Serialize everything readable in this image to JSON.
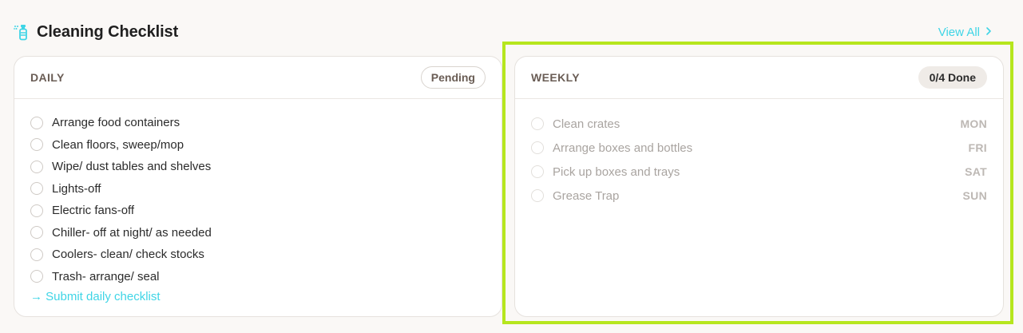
{
  "header": {
    "title": "Cleaning Checklist",
    "icon": "spray-bottle-icon",
    "view_all_label": "View All",
    "accent_color": "#3fd5e6"
  },
  "daily": {
    "label": "DAILY",
    "status": "Pending",
    "items": [
      {
        "text": "Arrange food containers",
        "checked": false
      },
      {
        "text": "Clean floors, sweep/mop",
        "checked": false
      },
      {
        "text": "Wipe/ dust tables and shelves",
        "checked": false
      },
      {
        "text": "Lights-off",
        "checked": false
      },
      {
        "text": "Electric fans-off",
        "checked": false
      },
      {
        "text": "Chiller- off at night/ as needed",
        "checked": false
      },
      {
        "text": "Coolers- clean/ check stocks",
        "checked": false
      },
      {
        "text": "Trash- arrange/ seal",
        "checked": false
      }
    ],
    "submit_label": "→ Submit daily checklist"
  },
  "weekly": {
    "label": "WEEKLY",
    "progress": "0/4 Done",
    "items": [
      {
        "text": "Clean crates",
        "day": "MON",
        "checked": false
      },
      {
        "text": "Arrange boxes and bottles",
        "day": "FRI",
        "checked": false
      },
      {
        "text": "Pick up boxes and trays",
        "day": "SAT",
        "checked": false
      },
      {
        "text": "Grease Trap",
        "day": "SUN",
        "checked": false
      }
    ]
  },
  "highlight_color": "#b6e61e"
}
